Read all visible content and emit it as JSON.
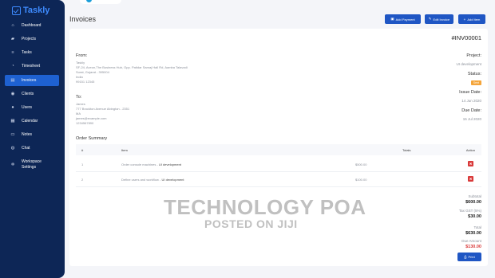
{
  "app": {
    "name": "Taskly"
  },
  "sidebar": {
    "items": [
      {
        "label": "Dashboard",
        "icon": "home-icon"
      },
      {
        "label": "Projects",
        "icon": "briefcase-icon"
      },
      {
        "label": "Tasks",
        "icon": "tasks-icon"
      },
      {
        "label": "Timesheet",
        "icon": "clock-icon"
      },
      {
        "label": "Invoices",
        "icon": "invoice-icon",
        "active": true
      },
      {
        "label": "Clients",
        "icon": "clients-icon"
      },
      {
        "label": "Users",
        "icon": "users-icon"
      },
      {
        "label": "Calendar",
        "icon": "calendar-icon"
      },
      {
        "label": "Notes",
        "icon": "notes-icon"
      },
      {
        "label": "Chat",
        "icon": "chat-icon"
      },
      {
        "label_line1": "Workspace",
        "label_line2": "Settings",
        "icon": "settings-icon"
      }
    ]
  },
  "header": {
    "title": "Invoices",
    "add_payment": "Add Payment",
    "edit_invoice": "Edit Invoice",
    "add_item": "Add Item"
  },
  "invoice": {
    "number": "#INV00001",
    "from_label": "From:",
    "from": [
      "Taskly",
      "SF-24, Aveon,The Business Hub, Opp. Patidar Samaj Hall Rd, Aamba Talavadi",
      "Surat, Gujarat - 395004",
      "India",
      "99151 12345"
    ],
    "to_label": "To:",
    "to": [
      "James",
      "777 Brockton Avenue Abington - 2351",
      "MA",
      "james@example.com",
      "1234567890"
    ],
    "project_label": "Project:",
    "project": "UI development",
    "status_label": "Status:",
    "status": "Sent",
    "issue_label": "Issue Date:",
    "issue_date": "14 Jun 2020",
    "due_label": "Due Date:",
    "due_date": "15 Jul 2020"
  },
  "order": {
    "title": "Order Summary",
    "columns": {
      "num": "#",
      "item": "Item",
      "totals": "Totals",
      "action": "Action"
    },
    "rows": [
      {
        "num": "1",
        "item": "Order console machines -",
        "project": "UI development",
        "total": "$500.00"
      },
      {
        "num": "2",
        "item": "Define users and workflow -",
        "project": "UI development",
        "total": "$100.00"
      }
    ]
  },
  "totals": {
    "subtotal_label": "Subtotal",
    "subtotal": "$600.00",
    "tax_label": "Tax GST (5%)",
    "tax": "$30.00",
    "total_label": "Total",
    "total": "$630.00",
    "due_label": "Due Amount",
    "due": "$130.00",
    "print_label": "Print"
  },
  "watermark": {
    "line1": "TECHNOLOGY POA",
    "line2": "POSTED ON JIJI"
  },
  "colors": {
    "sidebar": "#0d2656",
    "accent": "#1f56c4",
    "status": "#f4a53b",
    "danger": "#d93a3a"
  }
}
